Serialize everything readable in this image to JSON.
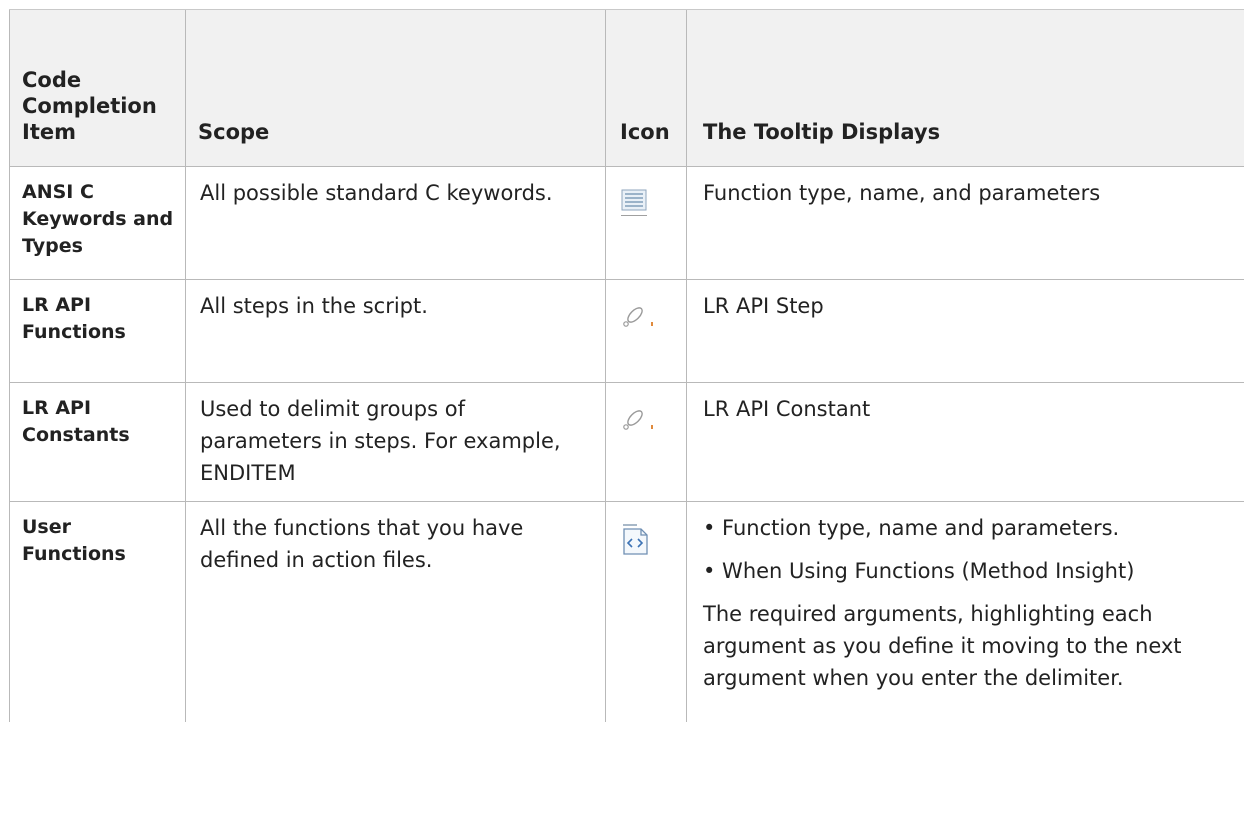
{
  "table": {
    "headers": {
      "item": "Code Completion Item",
      "scope": "Scope",
      "icon": "Icon",
      "tooltip": "The Tooltip Displays"
    },
    "rows": [
      {
        "item": "ANSI C Keywords and Types",
        "scope": "All possible standard C keywords.",
        "icon": "keyword-list-icon",
        "tooltip": "Function type, name, and parameters"
      },
      {
        "item": "LR API Functions",
        "scope": "All steps in the script.",
        "icon": "api-step-icon",
        "tooltip": "LR API Step"
      },
      {
        "item": "LR API Constants",
        "scope": "Used to delimit groups of parameters in steps. For example, ENDITEM",
        "icon": "api-constant-icon",
        "tooltip": "LR API Constant"
      },
      {
        "item": "User Functions",
        "scope": "All the functions that you have defined in action files.",
        "icon": "user-function-icon",
        "tooltip_bullets": [
          "• Function type, name and parameters.",
          "• When Using Functions (Method Insight)"
        ],
        "tooltip_para": "The required arguments, highlighting each argument as you define it moving to the next argument when you enter the delimiter."
      }
    ]
  }
}
